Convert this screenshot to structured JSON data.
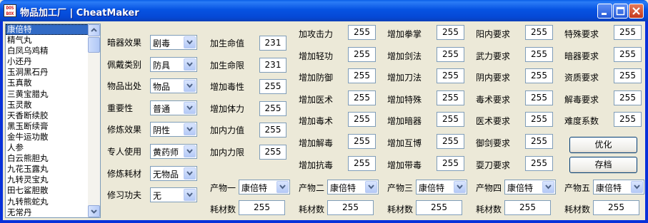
{
  "window": {
    "icon_text": "DOS BOX",
    "title": "物品加工厂  |  CheatMaker"
  },
  "item_list": {
    "items": [
      "康倍特",
      "精气丸",
      "白凤乌鸡精",
      "小还丹",
      "玉洞黑石丹",
      "玉真散",
      "三黄宝腊丸",
      "玉灵散",
      "天香断续胶",
      "黑玉断续膏",
      "金牛运功散",
      "人参",
      "白云熊胆丸",
      "九花玉露丸",
      "九转灵宝丸",
      "田七鲨胆散",
      "九转熊蛇丸",
      "无常丹"
    ],
    "selected": "康倍特"
  },
  "col1": [
    {
      "label": "暗器效果",
      "value": "剧毒"
    },
    {
      "label": "佩戴类别",
      "value": "防具"
    },
    {
      "label": "物品出处",
      "value": "物品"
    },
    {
      "label": "重要性",
      "value": "普通"
    },
    {
      "label": "修炼效果",
      "value": "阴性"
    },
    {
      "label": "专人使用",
      "value": "黄药师"
    },
    {
      "label": "修炼耗材",
      "value": "无物品"
    },
    {
      "label": "修习功夫",
      "value": "无"
    }
  ],
  "col2": [
    {
      "label": "加生命值",
      "value": "231"
    },
    {
      "label": "加生命限",
      "value": "231"
    },
    {
      "label": "增加毒性",
      "value": "255"
    },
    {
      "label": "增加体力",
      "value": "255"
    },
    {
      "label": "加内力值",
      "value": "255"
    },
    {
      "label": "加内力限",
      "value": "255"
    }
  ],
  "col3": [
    {
      "label": "加攻击力",
      "value": "255"
    },
    {
      "label": "增加轻功",
      "value": "255"
    },
    {
      "label": "增加防御",
      "value": "255"
    },
    {
      "label": "增加医术",
      "value": "255"
    },
    {
      "label": "增加毒术",
      "value": "255"
    },
    {
      "label": "增加解毒",
      "value": "255"
    },
    {
      "label": "增加抗毒",
      "value": "255"
    }
  ],
  "col4": [
    {
      "label": "增加拳掌",
      "value": "255"
    },
    {
      "label": "增加剑法",
      "value": "255"
    },
    {
      "label": "增加刀法",
      "value": "255"
    },
    {
      "label": "增加特殊",
      "value": "255"
    },
    {
      "label": "增加暗器",
      "value": "255"
    },
    {
      "label": "增加互博",
      "value": "255"
    },
    {
      "label": "增加带毒",
      "value": "255"
    }
  ],
  "col5": [
    {
      "label": "阳内要求",
      "value": "255"
    },
    {
      "label": "武力要求",
      "value": "255"
    },
    {
      "label": "阴内要求",
      "value": "255"
    },
    {
      "label": "毒术要求",
      "value": "255"
    },
    {
      "label": "医术要求",
      "value": "255"
    },
    {
      "label": "御剑要求",
      "value": "255"
    },
    {
      "label": "耍刀要求",
      "value": "255"
    }
  ],
  "col6": [
    {
      "label": "特殊要求",
      "value": "255"
    },
    {
      "label": "暗器要求",
      "value": "255"
    },
    {
      "label": "资质要求",
      "value": "255"
    },
    {
      "label": "解毒要求",
      "value": "255"
    },
    {
      "label": "难度系数",
      "value": "255"
    }
  ],
  "buttons": {
    "optimize": "优化",
    "save": "存档"
  },
  "products": [
    {
      "label": "产物一",
      "value": "康倍特",
      "cost_label": "耗材数",
      "cost": "255"
    },
    {
      "label": "产物二",
      "value": "康倍特",
      "cost_label": "耗材数",
      "cost": "255"
    },
    {
      "label": "产物三",
      "value": "康倍特",
      "cost_label": "耗材数",
      "cost": "255"
    },
    {
      "label": "产物四",
      "value": "康倍特",
      "cost_label": "耗材数",
      "cost": "255"
    },
    {
      "label": "产物五",
      "value": "康倍特",
      "cost_label": "耗材数",
      "cost": "255"
    }
  ],
  "colors": {
    "titlebar": "#0653e2",
    "face": "#ece9d8",
    "selection": "#316ac5",
    "border": "#7f9db9"
  }
}
